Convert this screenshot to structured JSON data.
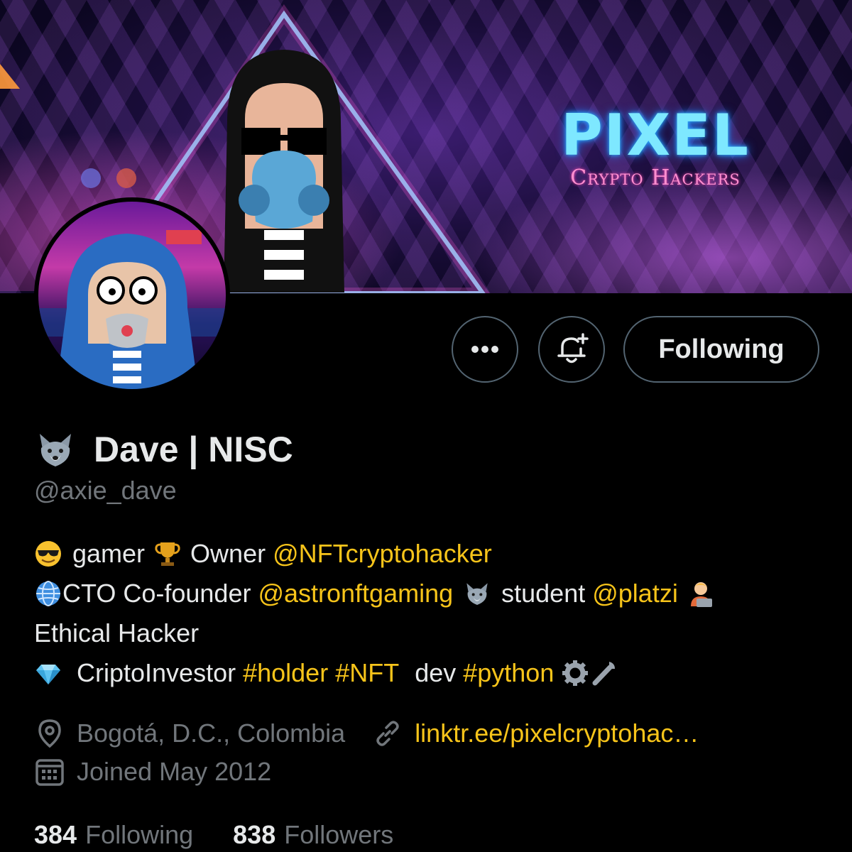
{
  "banner": {
    "brand_title": "PIXEL",
    "brand_subtitle": "Crypto Hackers"
  },
  "actions": {
    "more_icon": "more-horizontal-icon",
    "notify_icon": "bell-plus-icon",
    "follow_label": "Following"
  },
  "profile": {
    "name_emoji": "wolf-emoji",
    "display_name": "Dave | NISC",
    "handle": "@axie_dave"
  },
  "bio": {
    "line1": {
      "gamer": "gamer",
      "owner": "Owner",
      "owner_link": "@NFTcryptohacker"
    },
    "line2": {
      "cto": "CTO Co-founder",
      "cto_link": "@astronftgaming",
      "student": "student",
      "student_link": "@platzi"
    },
    "line3": "Ethical Hacker",
    "line4": {
      "investor": "CriptoInvestor",
      "tag1": "#holder",
      "tag2": "#NFT",
      "dev": "dev",
      "tag3": "#python"
    }
  },
  "meta": {
    "location": "Bogotá, D.C., Colombia",
    "website": "linktr.ee/pixelcryptohac…",
    "joined": "Joined May 2012"
  },
  "stats": {
    "following_count": "384",
    "following_label": "Following",
    "followers_count": "838",
    "followers_label": "Followers"
  },
  "colors": {
    "background": "#000000",
    "text": "#e7e9ea",
    "secondary": "#71767b",
    "link_accent": "#f7c41a",
    "border": "#536471"
  }
}
